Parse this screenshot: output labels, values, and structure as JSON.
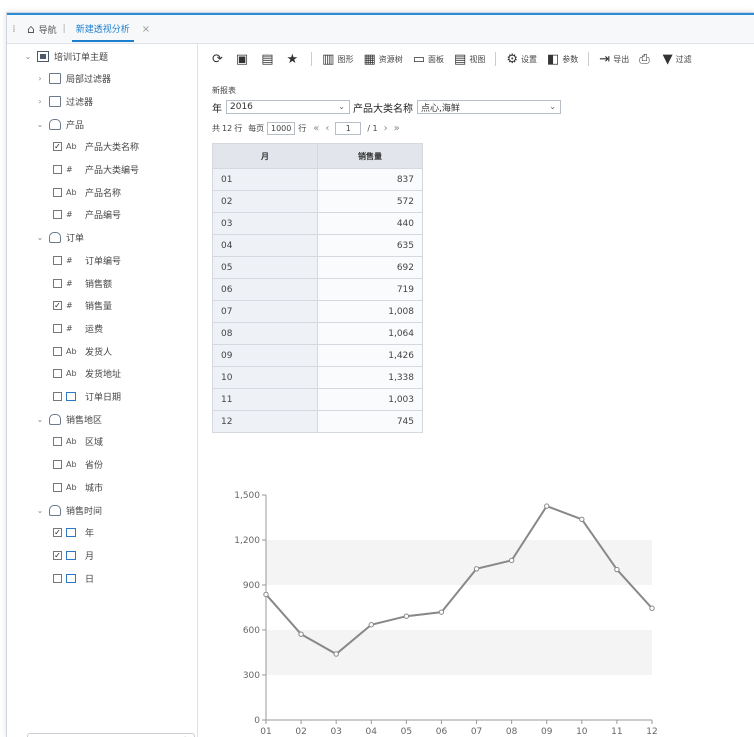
{
  "nav": {
    "home_label": "导航",
    "tab_label": "新建透视分析",
    "close_label": "×"
  },
  "sidebar": {
    "items": [
      {
        "level": 0,
        "arrow": "⌄",
        "icon": "cube",
        "label": "培训订单主题"
      },
      {
        "level": 1,
        "arrow": "›",
        "icon": "filter",
        "label": "局部过滤器"
      },
      {
        "level": 1,
        "arrow": "›",
        "icon": "folder",
        "label": "过滤器"
      },
      {
        "level": 1,
        "arrow": "⌄",
        "icon": "db",
        "label": "产品"
      },
      {
        "level": 2,
        "check": true,
        "ftype": "Ab",
        "label": "产品大类名称"
      },
      {
        "level": 2,
        "check": false,
        "ftype": "#",
        "label": "产品大类编号"
      },
      {
        "level": 2,
        "check": false,
        "ftype": "Ab",
        "label": "产品名称"
      },
      {
        "level": 2,
        "check": false,
        "ftype": "#",
        "label": "产品编号"
      },
      {
        "level": 1,
        "arrow": "⌄",
        "icon": "db",
        "label": "订单"
      },
      {
        "level": 2,
        "check": false,
        "ftype": "#",
        "label": "订单编号"
      },
      {
        "level": 2,
        "check": false,
        "ftype": "#",
        "label": "销售额"
      },
      {
        "level": 2,
        "check": true,
        "ftype": "#",
        "label": "销售量"
      },
      {
        "level": 2,
        "check": false,
        "ftype": "#",
        "label": "运费"
      },
      {
        "level": 2,
        "check": false,
        "ftype": "Ab",
        "label": "发货人"
      },
      {
        "level": 2,
        "check": false,
        "ftype": "Ab",
        "label": "发货地址"
      },
      {
        "level": 2,
        "check": false,
        "ftype": "cal",
        "label": "订单日期"
      },
      {
        "level": 1,
        "arrow": "⌄",
        "icon": "db",
        "label": "销售地区"
      },
      {
        "level": 2,
        "check": false,
        "ftype": "Ab",
        "label": "区域"
      },
      {
        "level": 2,
        "check": false,
        "ftype": "Ab",
        "label": "省份"
      },
      {
        "level": 2,
        "check": false,
        "ftype": "Ab",
        "label": "城市"
      },
      {
        "level": 1,
        "arrow": "⌄",
        "icon": "db",
        "label": "销售时间"
      },
      {
        "level": 2,
        "check": true,
        "ftype": "calY",
        "label": "年"
      },
      {
        "level": 2,
        "check": true,
        "ftype": "calM",
        "label": "月"
      },
      {
        "level": 2,
        "check": false,
        "ftype": "calD",
        "label": "日"
      }
    ],
    "search_placeholder": ""
  },
  "toolbar": {
    "items": [
      {
        "name": "refresh",
        "glyph": "⟳",
        "label": ""
      },
      {
        "name": "save",
        "glyph": "▣",
        "label": ""
      },
      {
        "name": "save-as",
        "glyph": "▤",
        "label": ""
      },
      {
        "name": "favorite",
        "glyph": "★",
        "label": ""
      },
      {
        "name": "chart",
        "glyph": "▥",
        "label": "图形"
      },
      {
        "name": "resource-tree",
        "glyph": "▦",
        "label": "资源树"
      },
      {
        "name": "panel",
        "glyph": "▭",
        "label": "面板"
      },
      {
        "name": "view",
        "glyph": "▤",
        "label": "视图"
      },
      {
        "name": "settings",
        "glyph": "⚙",
        "label": "设置"
      },
      {
        "name": "params",
        "glyph": "◧",
        "label": "参数"
      },
      {
        "name": "export",
        "glyph": "⇥",
        "label": "导出"
      },
      {
        "name": "print",
        "glyph": "⎙",
        "label": ""
      },
      {
        "name": "filter",
        "glyph": "▼",
        "label": "过滤"
      }
    ]
  },
  "report": {
    "new_label": "新报表",
    "year_label": "年",
    "year_value": "2016",
    "category_label": "产品大类名称",
    "category_value": "点心,海鲜",
    "pager": {
      "total_prefix": "共",
      "total_rows": "12",
      "total_suffix": "行",
      "per_page_label": "每页",
      "per_page_value": "1000",
      "per_page_suffix": "行",
      "current_page": "1",
      "total_pages": "/ 1"
    },
    "table": {
      "headers": [
        "月",
        "销售量"
      ],
      "rows": [
        [
          "01",
          "837"
        ],
        [
          "02",
          "572"
        ],
        [
          "03",
          "440"
        ],
        [
          "04",
          "635"
        ],
        [
          "05",
          "692"
        ],
        [
          "06",
          "719"
        ],
        [
          "07",
          "1,008"
        ],
        [
          "08",
          "1,064"
        ],
        [
          "09",
          "1,426"
        ],
        [
          "10",
          "1,338"
        ],
        [
          "11",
          "1,003"
        ],
        [
          "12",
          "745"
        ]
      ]
    }
  },
  "chart_data": {
    "type": "line",
    "categories": [
      "01",
      "02",
      "03",
      "04",
      "05",
      "06",
      "07",
      "08",
      "09",
      "10",
      "11",
      "12"
    ],
    "series": [
      {
        "values": [
          837,
          572,
          440,
          635,
          692,
          719,
          1008,
          1064,
          1426,
          1338,
          1003,
          745
        ]
      }
    ],
    "yticks": [
      "0",
      "300",
      "600",
      "900",
      "1,200",
      "1,500"
    ],
    "ylim": [
      0,
      1500
    ],
    "grid": true,
    "line_color": "#888888",
    "band_color": "#f4f4f4"
  }
}
